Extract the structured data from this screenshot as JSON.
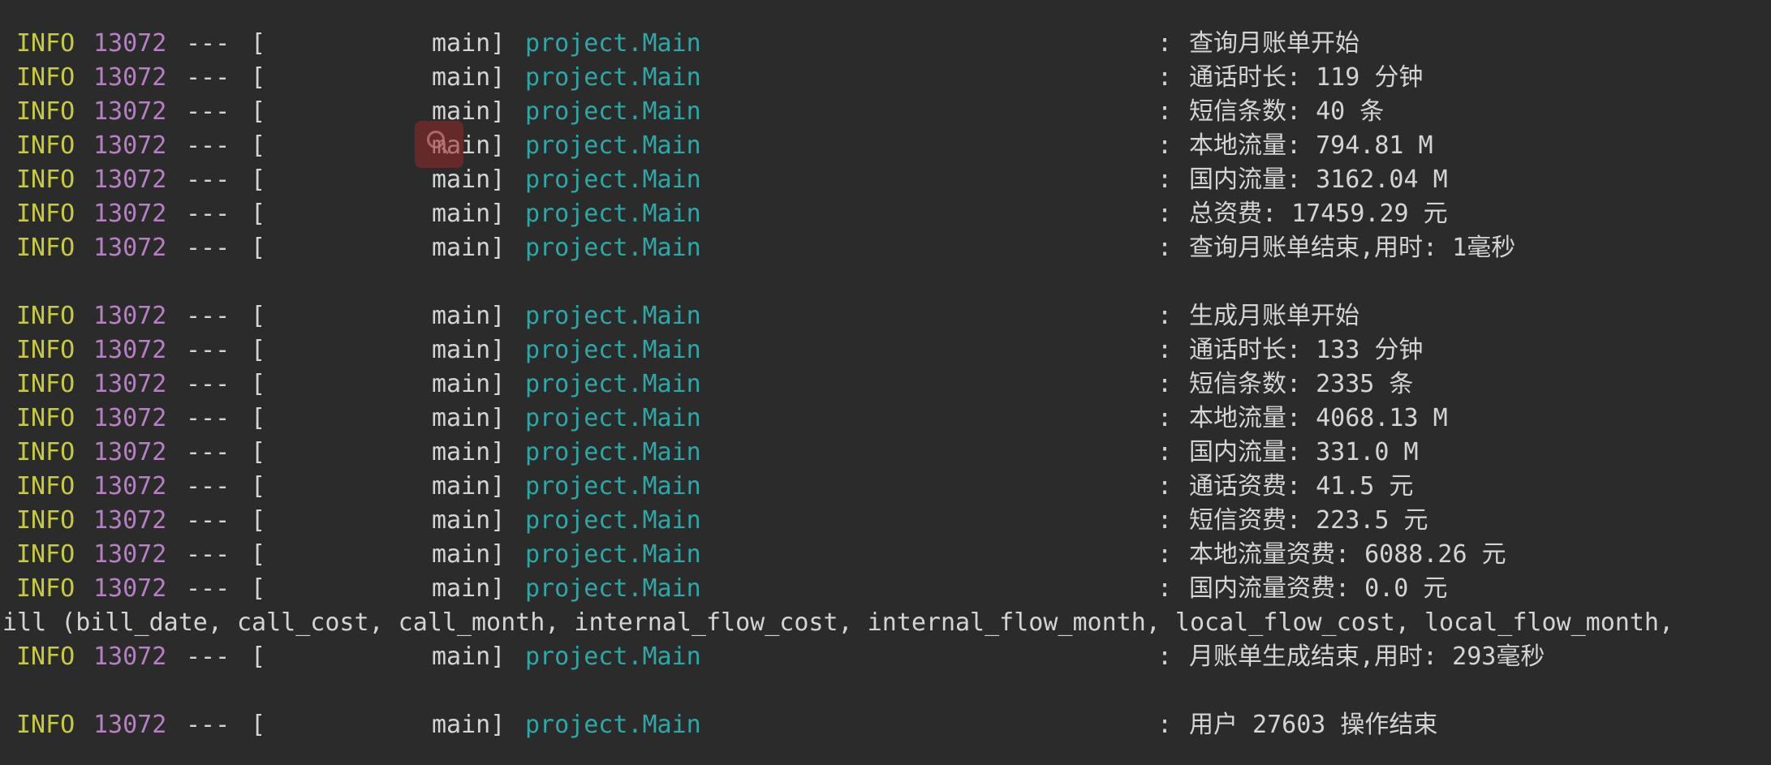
{
  "log": {
    "lines": [
      {
        "level": "INFO",
        "pid": "13072",
        "sep": "---",
        "bracket_open": "[",
        "thread": "main]",
        "logger": "project.Main",
        "colon": ":",
        "message": "查询月账单开始"
      },
      {
        "level": "INFO",
        "pid": "13072",
        "sep": "---",
        "bracket_open": "[",
        "thread": "main]",
        "logger": "project.Main",
        "colon": ":",
        "message": "通话时长: 119 分钟"
      },
      {
        "level": "INFO",
        "pid": "13072",
        "sep": "---",
        "bracket_open": "[",
        "thread": "main]",
        "logger": "project.Main",
        "colon": ":",
        "message": "短信条数: 40 条"
      },
      {
        "level": "INFO",
        "pid": "13072",
        "sep": "---",
        "bracket_open": "[",
        "thread": "main]",
        "logger": "project.Main",
        "colon": ":",
        "message": "本地流量: 794.81 M"
      },
      {
        "level": "INFO",
        "pid": "13072",
        "sep": "---",
        "bracket_open": "[",
        "thread": "main]",
        "logger": "project.Main",
        "colon": ":",
        "message": "国内流量: 3162.04 M"
      },
      {
        "level": "INFO",
        "pid": "13072",
        "sep": "---",
        "bracket_open": "[",
        "thread": "main]",
        "logger": "project.Main",
        "colon": ":",
        "message": "总资费: 17459.29 元"
      },
      {
        "level": "INFO",
        "pid": "13072",
        "sep": "---",
        "bracket_open": "[",
        "thread": "main]",
        "logger": "project.Main",
        "colon": ":",
        "message": "查询月账单结束,用时: 1毫秒"
      },
      {
        "level": "INFO",
        "pid": "13072",
        "sep": "---",
        "bracket_open": "[",
        "thread": "main]",
        "logger": "project.Main",
        "colon": ":",
        "message": "生成月账单开始"
      },
      {
        "level": "INFO",
        "pid": "13072",
        "sep": "---",
        "bracket_open": "[",
        "thread": "main]",
        "logger": "project.Main",
        "colon": ":",
        "message": "通话时长: 133 分钟"
      },
      {
        "level": "INFO",
        "pid": "13072",
        "sep": "---",
        "bracket_open": "[",
        "thread": "main]",
        "logger": "project.Main",
        "colon": ":",
        "message": "短信条数: 2335 条"
      },
      {
        "level": "INFO",
        "pid": "13072",
        "sep": "---",
        "bracket_open": "[",
        "thread": "main]",
        "logger": "project.Main",
        "colon": ":",
        "message": "本地流量: 4068.13 M"
      },
      {
        "level": "INFO",
        "pid": "13072",
        "sep": "---",
        "bracket_open": "[",
        "thread": "main]",
        "logger": "project.Main",
        "colon": ":",
        "message": "国内流量: 331.0 M"
      },
      {
        "level": "INFO",
        "pid": "13072",
        "sep": "---",
        "bracket_open": "[",
        "thread": "main]",
        "logger": "project.Main",
        "colon": ":",
        "message": "通话资费: 41.5 元"
      },
      {
        "level": "INFO",
        "pid": "13072",
        "sep": "---",
        "bracket_open": "[",
        "thread": "main]",
        "logger": "project.Main",
        "colon": ":",
        "message": "短信资费: 223.5 元"
      },
      {
        "level": "INFO",
        "pid": "13072",
        "sep": "---",
        "bracket_open": "[",
        "thread": "main]",
        "logger": "project.Main",
        "colon": ":",
        "message": "本地流量资费: 6088.26 元"
      },
      {
        "level": "INFO",
        "pid": "13072",
        "sep": "---",
        "bracket_open": "[",
        "thread": "main]",
        "logger": "project.Main",
        "colon": ":",
        "message": "国内流量资费: 0.0 元"
      },
      {
        "raw": "ill (bill_date, call_cost, call_month, internal_flow_cost, internal_flow_month, local_flow_cost, local_flow_month,"
      },
      {
        "level": "INFO",
        "pid": "13072",
        "sep": "---",
        "bracket_open": "[",
        "thread": "main]",
        "logger": "project.Main",
        "colon": ":",
        "message": "月账单生成结束,用时: 293毫秒"
      },
      {
        "level": "INFO",
        "pid": "13072",
        "sep": "---",
        "bracket_open": "[",
        "thread": "main]",
        "logger": "project.Main",
        "colon": ":",
        "message": "用户 27603 操作结束"
      }
    ]
  },
  "colors": {
    "background": "#2b2b2b",
    "level": "#c8cc3a",
    "pid": "#b77fc4",
    "logger": "#2ea8a6",
    "text": "#d4d4d4",
    "cursor_highlight": "#962828"
  },
  "icons": {
    "cursor": "search-cursor-icon"
  }
}
